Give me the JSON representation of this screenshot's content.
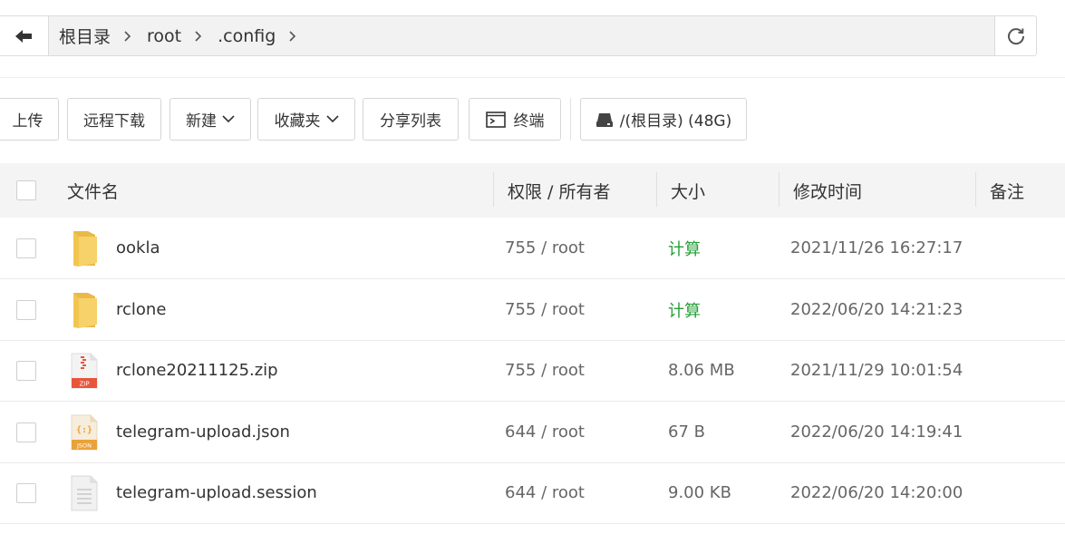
{
  "breadcrumb": {
    "items": [
      "根目录",
      "root",
      ".config"
    ]
  },
  "toolbar": {
    "upload": "上传",
    "remote_download": "远程下载",
    "new": "新建",
    "favorites": "收藏夹",
    "share_list": "分享列表",
    "terminal": "终端",
    "disk": "/(根目录) (48G)"
  },
  "table": {
    "headers": {
      "name": "文件名",
      "perm": "权限 / 所有者",
      "size": "大小",
      "mtime": "修改时间",
      "note": "备注"
    },
    "rows": [
      {
        "name": "ookla",
        "type": "folder",
        "perm": "755 / root",
        "size": "计算",
        "mtime": "2021/11/26 16:27:17"
      },
      {
        "name": "rclone",
        "type": "folder",
        "perm": "755 / root",
        "size": "计算",
        "mtime": "2022/06/20 14:21:23"
      },
      {
        "name": "rclone20211125.zip",
        "type": "zip",
        "perm": "755 / root",
        "size": "8.06 MB",
        "mtime": "2021/11/29 10:01:54"
      },
      {
        "name": "telegram-upload.json",
        "type": "json",
        "perm": "644 / root",
        "size": "67 B",
        "mtime": "2022/06/20 14:19:41"
      },
      {
        "name": "telegram-upload.session",
        "type": "file",
        "perm": "644 / root",
        "size": "9.00 KB",
        "mtime": "2022/06/20 14:20:00"
      }
    ]
  },
  "icons": {
    "zip_label": "ZIP",
    "json_label": "JSON",
    "json_braces": "{:}"
  },
  "colors": {
    "calc_green": "#27a139",
    "folder_yellow": "#f7d26b",
    "zip_red": "#e8553b",
    "json_orange": "#e9a23b"
  }
}
